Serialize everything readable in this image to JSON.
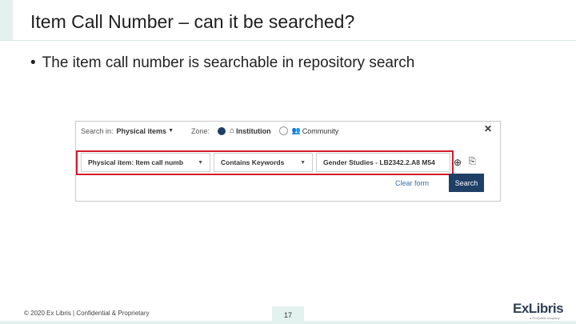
{
  "slide": {
    "title": "Item Call Number – can it be searched?",
    "bullet": "The item call number is searchable in repository search"
  },
  "search_panel": {
    "search_in_label": "Search in:",
    "search_in_value": "Physical items",
    "zone_label": "Zone:",
    "zone_institution": "Institution",
    "zone_community": "Community",
    "field_label": "Physical item: Item call numb",
    "operator_label": "Contains Keywords",
    "query_value": "Gender Studies - LB2342.2.A8 M54",
    "clear_form": "Clear form",
    "search_button": "Search",
    "accent_color": "#1f3f66",
    "highlight_color": "#d31a2c"
  },
  "footer": {
    "copyright": "© 2020 Ex Libris | Confidential & Proprietary",
    "page_number": "17",
    "logo_text": "ExLibris",
    "logo_subtext": "a ProQuest company"
  }
}
